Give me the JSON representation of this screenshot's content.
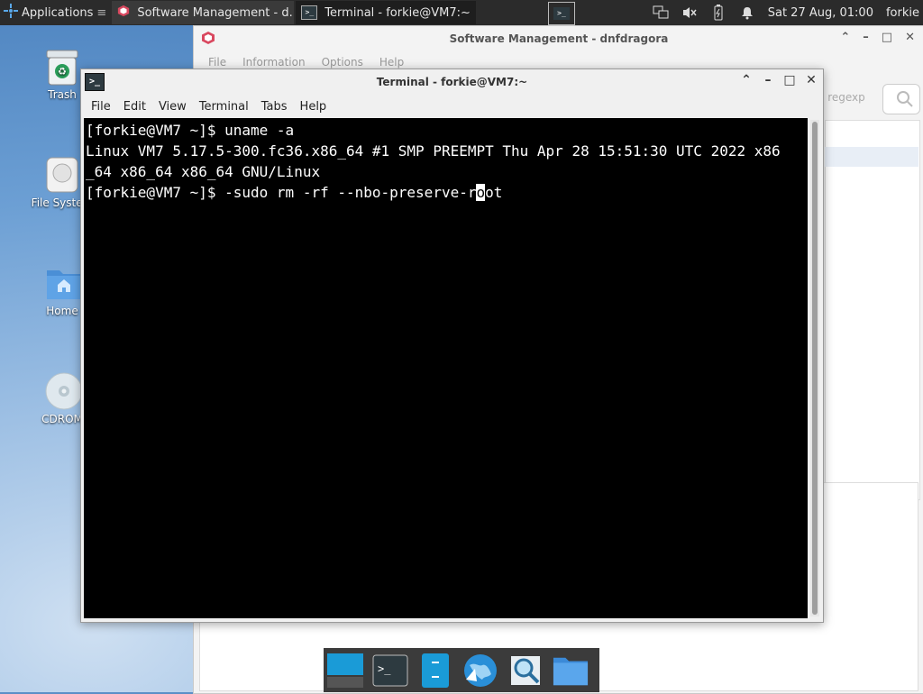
{
  "panel": {
    "applications_label": "Applications",
    "tasks": [
      {
        "label": "Software Management - d...",
        "icon": "package-icon"
      },
      {
        "label": "Terminal - forkie@VM7:~",
        "icon": "terminal-icon"
      }
    ],
    "clock": "Sat 27 Aug, 01:00",
    "user": "forkie"
  },
  "desktop_icons": [
    {
      "label": "Trash",
      "icon": "trash-icon"
    },
    {
      "label": "File System",
      "icon": "drive-icon"
    },
    {
      "label": "Home",
      "icon": "home-folder-icon"
    },
    {
      "label": "CDROM",
      "icon": "cdrom-icon"
    }
  ],
  "software_window": {
    "title": "Software Management - dnfdragora",
    "menu": [
      "File",
      "Information",
      "Options",
      "Help"
    ],
    "search_hint": "e regexp"
  },
  "terminal": {
    "title": "Terminal - forkie@VM7:~",
    "menu": [
      "File",
      "Edit",
      "View",
      "Terminal",
      "Tabs",
      "Help"
    ],
    "lines": [
      "[forkie@VM7 ~]$ uname -a",
      "Linux VM7 5.17.5-300.fc36.x86_64 #1 SMP PREEMPT Thu Apr 28 15:51:30 UTC 2022 x86",
      "_64 x86_64 x86_64 GNU/Linux"
    ],
    "prompt": "[forkie@VM7 ~]$ ",
    "current_input_before_cursor": "-sudo rm -rf --nbo-preserve-r",
    "cursor_char": "o",
    "current_input_after_cursor": "ot"
  },
  "dock": [
    "desktop-icon",
    "terminal-icon",
    "files-icon",
    "browser-icon",
    "search-icon",
    "folder-icon"
  ],
  "colors": {
    "panel": "#2b2b2b",
    "terminal_bg": "#000000",
    "terminal_fg": "#ffffff",
    "accent": "#1a9bd7"
  }
}
